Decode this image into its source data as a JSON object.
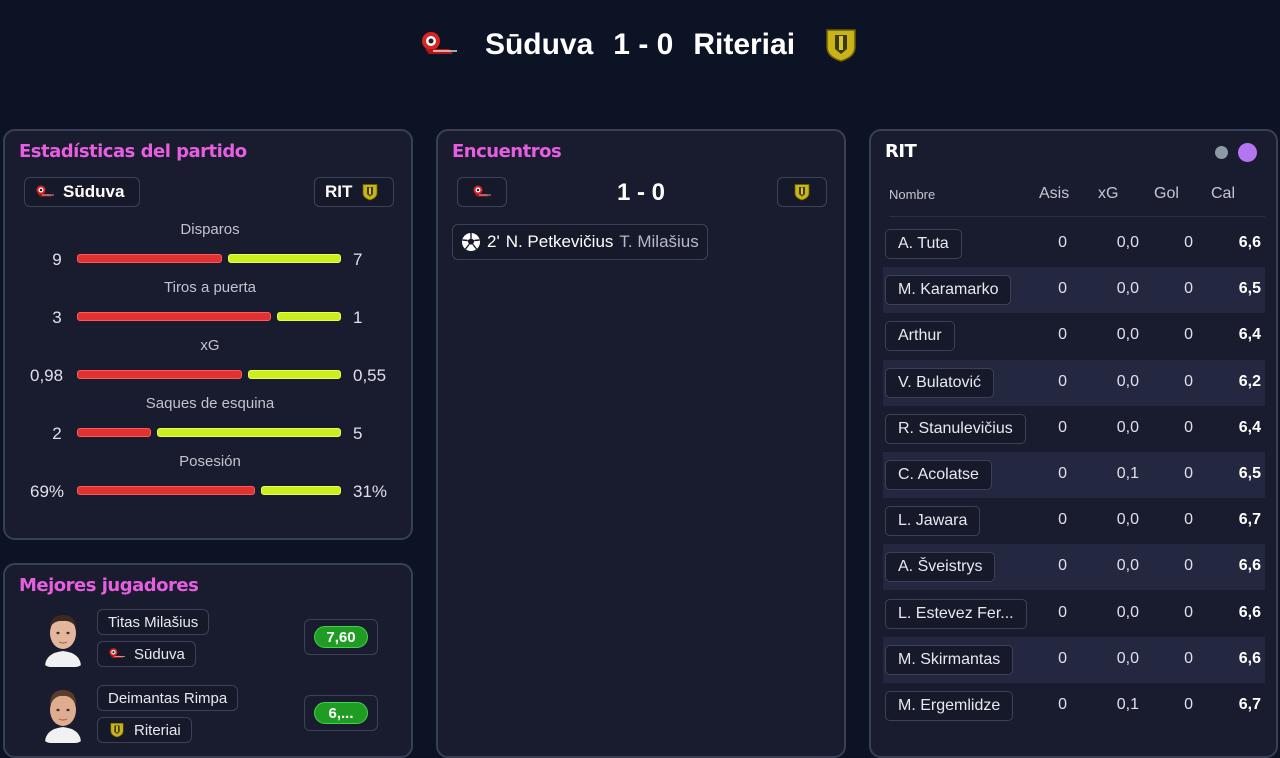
{
  "match": {
    "home": "Sūduva",
    "score": "1 - 0",
    "away": "Riteriai"
  },
  "stats_panel": {
    "title": "Estadísticas del partido",
    "home_label": "Sūduva",
    "away_label": "RIT",
    "stats": [
      {
        "label": "Disparos",
        "home": "9",
        "away": "7",
        "home_share": 0.5625
      },
      {
        "label": "Tiros a puerta",
        "home": "3",
        "away": "1",
        "home_share": 0.75
      },
      {
        "label": "xG",
        "home": "0,98",
        "away": "0,55",
        "home_share": 0.64
      },
      {
        "label": "Saques de esquina",
        "home": "2",
        "away": "5",
        "home_share": 0.2857
      },
      {
        "label": "Posesión",
        "home": "69%",
        "away": "31%",
        "home_share": 0.69
      }
    ]
  },
  "best_players": {
    "title": "Mejores jugadores",
    "players": [
      {
        "name": "Titas Milašius",
        "team": "Sūduva",
        "rating": "7,60"
      },
      {
        "name": "Deimantas Rimpa",
        "team": "Riteriai",
        "rating": "6,..."
      }
    ]
  },
  "encounters": {
    "title": "Encuentros",
    "score": "1 - 0",
    "event": {
      "minute": "2'",
      "scorer": "N. Petkevičius",
      "assist": "T. Milašius"
    }
  },
  "lineup": {
    "team": "RIT",
    "headers": {
      "name": "Nombre",
      "assists": "Asis",
      "xg": "xG",
      "goals": "Gol",
      "rating": "Cal"
    },
    "rows": [
      {
        "name": "A. Tuta",
        "assists": "0",
        "xg": "0,0",
        "goals": "0",
        "rating": "6,6"
      },
      {
        "name": "M. Karamarko",
        "assists": "0",
        "xg": "0,0",
        "goals": "0",
        "rating": "6,5"
      },
      {
        "name": "Arthur",
        "assists": "0",
        "xg": "0,0",
        "goals": "0",
        "rating": "6,4"
      },
      {
        "name": "V. Bulatović",
        "assists": "0",
        "xg": "0,0",
        "goals": "0",
        "rating": "6,2"
      },
      {
        "name": "R. Stanulevičius",
        "assists": "0",
        "xg": "0,0",
        "goals": "0",
        "rating": "6,4"
      },
      {
        "name": "C. Acolatse",
        "assists": "0",
        "xg": "0,1",
        "goals": "0",
        "rating": "6,5"
      },
      {
        "name": "L. Jawara",
        "assists": "0",
        "xg": "0,0",
        "goals": "0",
        "rating": "6,7"
      },
      {
        "name": "A. Šveistrys",
        "assists": "0",
        "xg": "0,0",
        "goals": "0",
        "rating": "6,6"
      },
      {
        "name": "L. Estevez Fer...",
        "assists": "0",
        "xg": "0,0",
        "goals": "0",
        "rating": "6,6"
      },
      {
        "name": "M. Skirmantas",
        "assists": "0",
        "xg": "0,0",
        "goals": "0",
        "rating": "6,6"
      },
      {
        "name": "M. Ergemlidze",
        "assists": "0",
        "xg": "0,1",
        "goals": "0",
        "rating": "6,7"
      }
    ]
  },
  "colors": {
    "home_bar": "#e23131",
    "away_bar": "#cdee1e",
    "accent_title": "#e85ee0",
    "rating_good": "#1f9c23",
    "toggle_active": "#b476f0",
    "toggle_inactive": "#8b9aa3"
  },
  "icons": {
    "home_crest": "suduva-crest-icon",
    "away_crest": "riteriai-crest-icon",
    "goal": "soccer-ball-icon"
  }
}
